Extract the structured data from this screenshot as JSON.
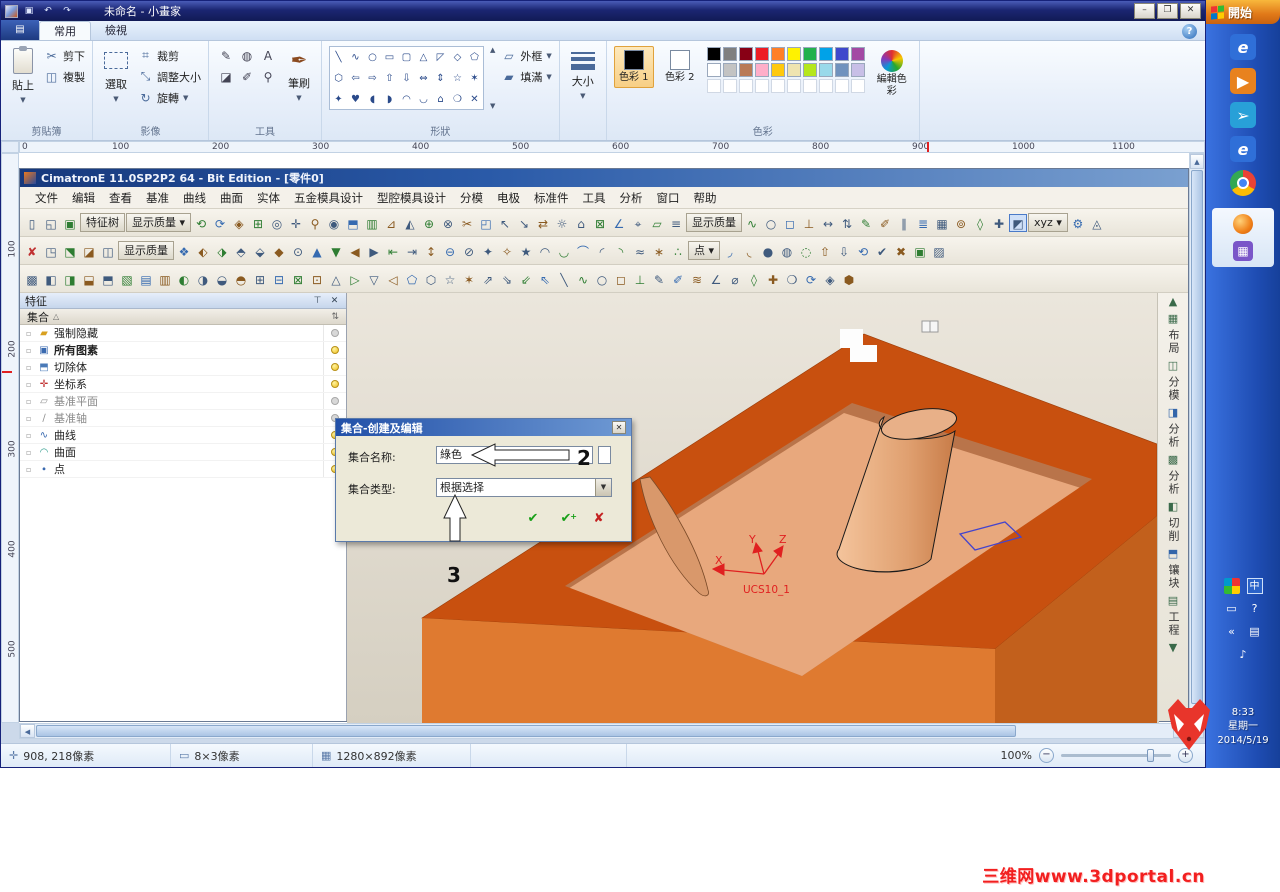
{
  "paint": {
    "window_title": "未命名 - 小畫家",
    "qat_icons": [
      "▣",
      "↶",
      "↷"
    ],
    "window_buttons": {
      "min": "–",
      "restore": "❐",
      "close": "✕"
    },
    "file_button": "▤",
    "tabs": [
      {
        "label": "常用",
        "active": true
      },
      {
        "label": "檢視",
        "active": false
      }
    ],
    "help": "?",
    "ribbon": {
      "clipboard": {
        "group": "剪貼簿",
        "paste": "貼上",
        "cut": "剪下",
        "copy": "複製"
      },
      "image": {
        "group": "影像",
        "select": "選取",
        "crop": "裁剪",
        "resize": "調整大小",
        "rotate": "旋轉"
      },
      "tools": {
        "group": "工具",
        "brush": "筆刷",
        "brush_glyph": "✒",
        "items": [
          {
            "glyph": "✎",
            "name": "pencil-icon"
          },
          {
            "glyph": "◍",
            "name": "fill-bucket-icon"
          },
          {
            "glyph": "A",
            "name": "text-tool-icon"
          },
          {
            "glyph": "◪",
            "name": "eraser-icon"
          },
          {
            "glyph": "✐",
            "name": "color-picker-icon"
          },
          {
            "glyph": "⚲",
            "name": "magnifier-icon"
          }
        ]
      },
      "shapes": {
        "group": "形狀",
        "outline": "外框",
        "fill": "填滿",
        "glyphs": [
          "╲",
          "∿",
          "○",
          "▭",
          "▢",
          "△",
          "◸",
          "◇",
          "⬠",
          "⬡",
          "⇦",
          "⇨",
          "⇧",
          "⇩",
          "⇔",
          "⇕",
          "☆",
          "✶",
          "✦",
          "♥",
          "◖",
          "◗",
          "◠",
          "◡",
          "⌂",
          "❍",
          "✕"
        ]
      },
      "size": {
        "label": "大小"
      },
      "colors": {
        "group": "色彩",
        "color1": "色彩 1",
        "color2": "色彩 2",
        "edit": "編輯色彩",
        "color1_value": "#000000",
        "color2_value": "#ffffff",
        "palette": [
          [
            "#000000",
            "#7f7f7f",
            "#880015",
            "#ed1c24",
            "#ff7f27",
            "#fff200",
            "#22b14c",
            "#00a2e8",
            "#3f48cc",
            "#a349a4"
          ],
          [
            "#ffffff",
            "#c3c3c3",
            "#b97a57",
            "#ffaec9",
            "#ffc90e",
            "#efe4b0",
            "#b5e61d",
            "#99d9ea",
            "#7092be",
            "#c8bfe7"
          ],
          [
            "#ffffff",
            "#ffffff",
            "#ffffff",
            "#ffffff",
            "#ffffff",
            "#ffffff",
            "#ffffff",
            "#ffffff",
            "#ffffff",
            "#ffffff"
          ]
        ]
      }
    },
    "ruler_h": [
      "0",
      "100",
      "200",
      "300",
      "400",
      "500",
      "600",
      "700",
      "800",
      "900",
      "1000",
      "1100"
    ],
    "ruler_v": [
      "100",
      "200",
      "300",
      "400",
      "500"
    ],
    "status": {
      "coords": "908, 218像素",
      "selection": "8×3像素",
      "image_size": "1280×892像素",
      "zoom": "100%",
      "icons": {
        "coords_icon": "✛",
        "selection_icon": "▭",
        "size_icon": "▦",
        "minus": "−",
        "plus": "+"
      }
    }
  },
  "cimatron": {
    "title": "CimatronE 11.0SP2P2 64 - Bit Edition - [零件0]",
    "menus": [
      "文件",
      "编辑",
      "查看",
      "基准",
      "曲线",
      "曲面",
      "实体",
      "五金模具设计",
      "型腔模具设计",
      "分模",
      "电极",
      "标准件",
      "工具",
      "分析",
      "窗口",
      "帮助"
    ],
    "toolbar1": [
      "▯",
      "◱",
      "▣",
      {
        "label": "特征树"
      },
      {
        "label": "显示质量 ▾"
      },
      "⟲",
      "⟳",
      "◈",
      "⊞",
      "◎",
      "✛",
      "⚲",
      "◉",
      "⬒",
      "▥",
      "⊿",
      "◭",
      "⊕",
      "⊗",
      "✂",
      "◰",
      "↖",
      "↘",
      "⇄",
      "☼",
      "⌂",
      "⊠",
      "∠",
      "⌖",
      "▱",
      "≡",
      {
        "label": "显示质量"
      },
      "∿",
      "○",
      "◻",
      "⊥",
      "↔",
      "⇅",
      "✎",
      "✐",
      "∥",
      "≣",
      "▦",
      "⊚",
      "◊",
      "✚",
      {
        "glyph": "◩",
        "sel": true
      },
      {
        "label": "xyz ▾"
      },
      "⚙",
      "◬"
    ],
    "toolbar2": [
      "✘",
      "◳",
      "⬔",
      "◪",
      "◫",
      {
        "label": "显示质量"
      },
      "❖",
      "⬖",
      "⬗",
      "⬘",
      "⬙",
      "◆",
      "⊙",
      "▲",
      "▼",
      "◀",
      "▶",
      "⇤",
      "⇥",
      "↕",
      "⊖",
      "⊘",
      "✦",
      "✧",
      "★",
      "◠",
      "◡",
      "⌒",
      "◜",
      "◝",
      "≈",
      "∗",
      "∴",
      {
        "label": "点 ▾"
      },
      "◞",
      "◟",
      "●",
      "◍",
      "◌",
      "⇧",
      "⇩",
      "⟲",
      "✔",
      "✖",
      "▣",
      "▨"
    ],
    "toolbar3": [
      "▩",
      "◧",
      "◨",
      "⬓",
      "⬒",
      "▧",
      "▤",
      "▥",
      "◐",
      "◑",
      "◒",
      "◓",
      "⊞",
      "⊟",
      "⊠",
      "⊡",
      "△",
      "▷",
      "▽",
      "◁",
      "⬠",
      "⬡",
      "☆",
      "✶",
      "⇗",
      "⇘",
      "⇙",
      "⇖",
      "╲",
      "∿",
      "○",
      "◻",
      "⊥",
      "✎",
      "✐",
      "≋",
      "∠",
      "⌀",
      "◊",
      "✚",
      "❍",
      "⟳",
      "◈",
      "⬢"
    ],
    "feature_panel": {
      "title": "特征",
      "pin": "⊤",
      "close": "✕",
      "column_header": "集合",
      "sort_glyph": "△",
      "header_tool": "⇅",
      "rows": [
        {
          "label": "强制隐藏",
          "icon": "▰",
          "icon_color": "#d8a020",
          "bulb": "dim",
          "style": ""
        },
        {
          "label": "所有图素",
          "icon": "▣",
          "icon_color": "#3a6ab0",
          "bulb": "on",
          "style": "bold"
        },
        {
          "label": "切除体",
          "icon": "⬒",
          "icon_color": "#4a7ab8",
          "bulb": "on",
          "style": ""
        },
        {
          "label": "坐标系",
          "icon": "✛",
          "icon_color": "#c03030",
          "bulb": "on",
          "style": ""
        },
        {
          "label": "基准平面",
          "icon": "▱",
          "icon_color": "#909090",
          "bulb": "dim",
          "style": "dim"
        },
        {
          "label": "基准轴",
          "icon": "∕",
          "icon_color": "#909090",
          "bulb": "dim",
          "style": "dim"
        },
        {
          "label": "曲线",
          "icon": "∿",
          "icon_color": "#3a6ab0",
          "bulb": "on",
          "style": ""
        },
        {
          "label": "曲面",
          "icon": "◠",
          "icon_color": "#2a9a8a",
          "bulb": "on",
          "style": ""
        },
        {
          "label": "点",
          "icon": "∙",
          "icon_color": "#3a6ab0",
          "bulb": "on",
          "style": ""
        }
      ]
    },
    "dialog": {
      "title": "集合-创建及编辑",
      "close": "✕",
      "name_label": "集合名称:",
      "name_value": "綠色",
      "type_label": "集合类型:",
      "type_value": "根据选择",
      "dropdown_arrow": "▼",
      "ok_glyph": "✔",
      "apply_glyph": "✔",
      "apply_plus": "+",
      "cancel_glyph": "✘",
      "callout_2": "2",
      "callout_3": "3"
    },
    "viewport": {
      "ucs": {
        "x": "X",
        "y": "Y",
        "z": "Z",
        "label": "UCS10_1"
      },
      "colors": {
        "bg_top": "#ebe6dc",
        "bg_bottom": "#d5cfc1",
        "top_face": "#c8500f",
        "front_face": "#df7a30",
        "right_face": "#c2601c",
        "pocket_wall": "#b9744a",
        "pocket_floor": "#e8a87d",
        "cylinder_light": "#f4c49c",
        "cylinder_dark": "#c87c48",
        "blade": "#d9986b",
        "axis": "#e02020",
        "highlight": "#4444cc"
      }
    },
    "right_bar": [
      {
        "icon": "▲"
      },
      {
        "icon": "▦"
      },
      {
        "label": "布局"
      },
      {
        "icon": "◫"
      },
      {
        "label": "分模"
      },
      {
        "icon": "◨"
      },
      {
        "label": "分析"
      },
      {
        "icon": "▩"
      },
      {
        "label": "分析"
      },
      {
        "icon": "◧"
      },
      {
        "label": "切削"
      },
      {
        "icon": "⬒"
      },
      {
        "label": "镶块"
      },
      {
        "icon": "▤"
      },
      {
        "label": "工程"
      },
      {
        "icon": "▼"
      }
    ]
  },
  "taskbar": {
    "start": "開始",
    "apps": [
      {
        "name": "ie-icon",
        "glyph": "e",
        "fg": "#ffffff",
        "bg": "#2f6fd8"
      },
      {
        "name": "media-app-icon",
        "glyph": "▶",
        "fg": "#ffffff",
        "bg": "#e8821e"
      },
      {
        "name": "mail-app-icon",
        "glyph": "➢",
        "fg": "#ffffff",
        "bg": "#28a0d8"
      },
      {
        "name": "ie-icon-2",
        "glyph": "e",
        "fg": "#ffffff",
        "bg": "#2f6fd8"
      },
      {
        "name": "chrome-icon",
        "chrome": true
      }
    ],
    "running": [
      {
        "name": "firefox-icon",
        "fire": true
      },
      {
        "name": "paint-task-icon",
        "glyph": "▦",
        "fg": "#ffffff",
        "bg": "#7a56c8"
      }
    ],
    "tray": [
      {
        "name": "display-color-icon",
        "glyph": "",
        "cls": "grid4"
      },
      {
        "name": "ime-chinese-icon",
        "glyph": "中",
        "cls": "ime"
      },
      {
        "name": "monitor-icon",
        "glyph": "▭",
        "cls": ""
      },
      {
        "name": "help-tray-icon",
        "glyph": "?",
        "cls": ""
      },
      {
        "name": "collapse-icon",
        "glyph": "«",
        "cls": ""
      },
      {
        "name": "tray-app-icon",
        "glyph": "▤",
        "cls": ""
      },
      {
        "name": "volume-icon",
        "glyph": "♪",
        "cls": ""
      }
    ],
    "clock": {
      "time": "8:33",
      "day": "星期一",
      "date": "2014/5/19"
    }
  },
  "watermark": {
    "text": "三维网www.3dportal.cn"
  }
}
